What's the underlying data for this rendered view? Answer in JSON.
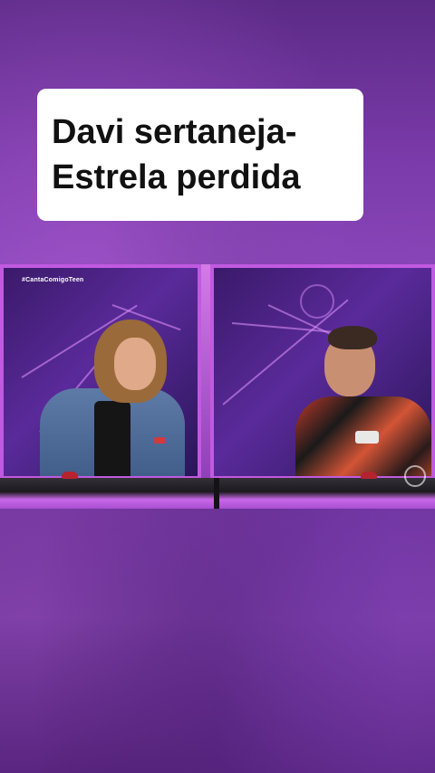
{
  "caption": {
    "line1": "Davi sertaneja-",
    "line2": "Estrela perdida"
  },
  "video": {
    "hashtag": "#CantaComigoTeen"
  },
  "colors": {
    "background": "#7a3aa8",
    "panel_border": "#c05ae0",
    "caption_bg": "#ffffff",
    "caption_text": "#111111"
  }
}
